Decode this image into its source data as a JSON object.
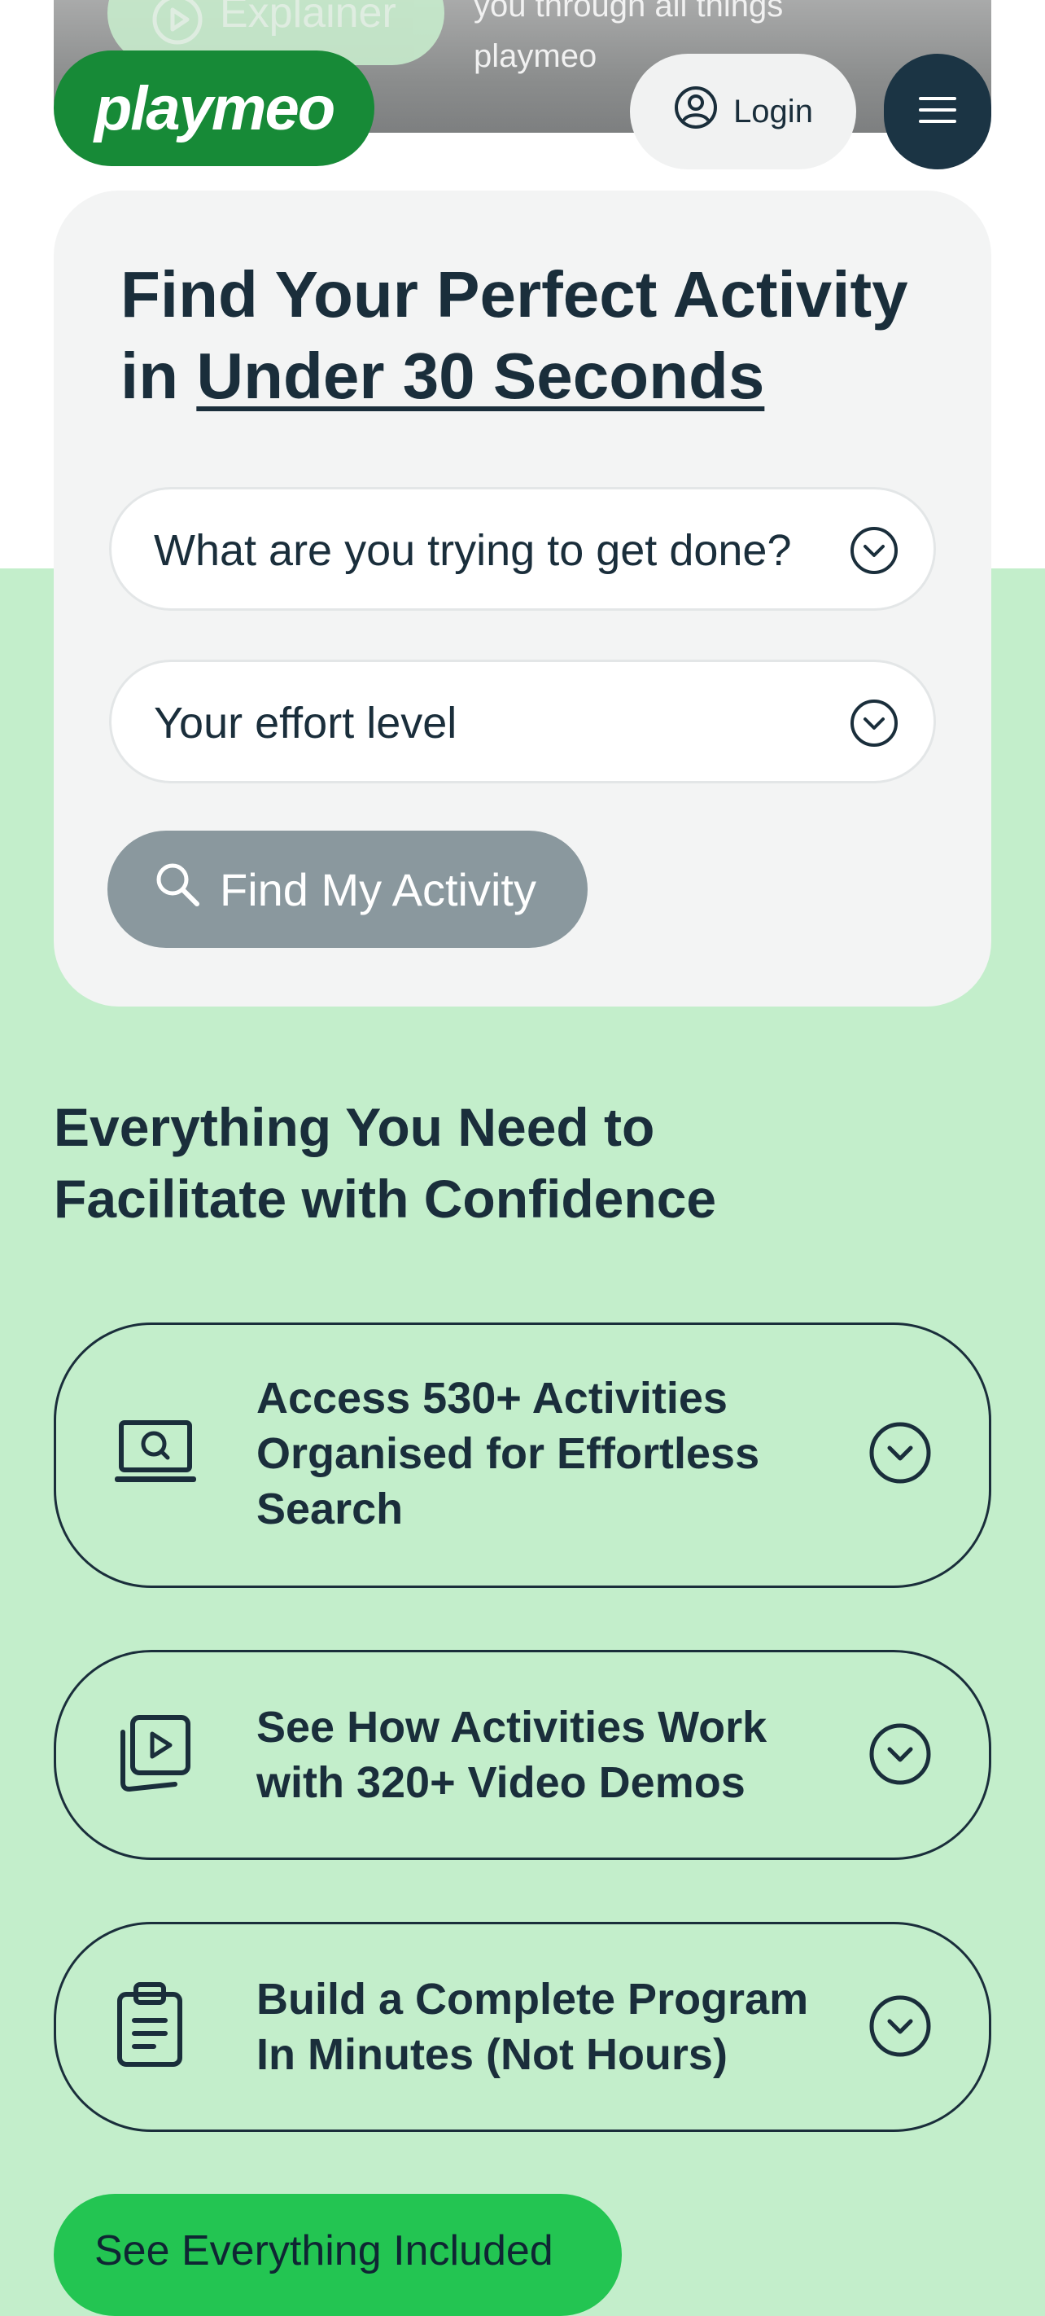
{
  "hero": {
    "explainer_label": "Explainer",
    "caption": "you through all things playmeo"
  },
  "header": {
    "logo_text": "playmeo",
    "login_label": "Login"
  },
  "finder": {
    "title_part1": "Find Your Perfect Activity in ",
    "title_underlined": "Under 30 Seconds",
    "goal_placeholder": "What are you trying to get done?",
    "effort_placeholder": "Your effort level",
    "find_button": "Find My Activity"
  },
  "features": {
    "title": "Everything You Need to Facilitate with Confidence",
    "items": [
      {
        "label": "Access 530+ Activities Organised for Effortless Search",
        "icon": "laptop-search-icon"
      },
      {
        "label": "See How Activities Work with 320+ Video Demos",
        "icon": "video-play-icon"
      },
      {
        "label": "Build a Complete Program In Minutes (Not Hours)",
        "icon": "clipboard-icon"
      }
    ],
    "see_all_label": "See Everything Included"
  },
  "colors": {
    "brand_green": "#178a37",
    "accent_green": "#23c552",
    "mint_bg": "#c3eecb",
    "navy": "#1a2e3b"
  }
}
